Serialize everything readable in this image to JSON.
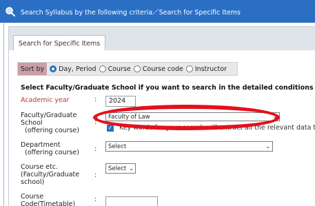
{
  "window": {
    "title": "Search Syllabus by the following criteria／Search for Specific Items",
    "icon": "search-icon",
    "title_color": "#2a6fc4"
  },
  "tabs": [
    {
      "label": "Search for Specific Items",
      "active": true
    }
  ],
  "sort": {
    "label": "Sort by",
    "options": [
      {
        "label": "Day, Period",
        "selected": true
      },
      {
        "label": "Course",
        "selected": false
      },
      {
        "label": "Course code",
        "selected": false
      },
      {
        "label": "Instructor",
        "selected": false
      }
    ]
  },
  "heading": "Select Faculty/Graduate School if you want to search in the detailed conditions <",
  "fields": {
    "academic_year": {
      "label": "Academic year",
      "colon": ":",
      "value": "2024"
    },
    "faculty": {
      "label_lines": [
        "Faculty/Graduate",
        "School",
        "(offering course)"
      ],
      "colon": ":",
      "value": "Faculty of Law",
      "checkbox_label": "Key words for your search will extract all the relevant data that"
    },
    "department": {
      "label_lines": [
        "Department",
        "(offering course)"
      ],
      "colon": ":",
      "value": "Select"
    },
    "course_etc": {
      "label_lines": [
        "Course etc.",
        "(Faculty/Graduate",
        "school)"
      ],
      "colon": ":",
      "value": "Select"
    },
    "course_code": {
      "label_lines": [
        "Course",
        "Code(Timetable)"
      ],
      "colon": ":",
      "value": ""
    }
  },
  "annotation": {
    "color": "#e4101c"
  }
}
